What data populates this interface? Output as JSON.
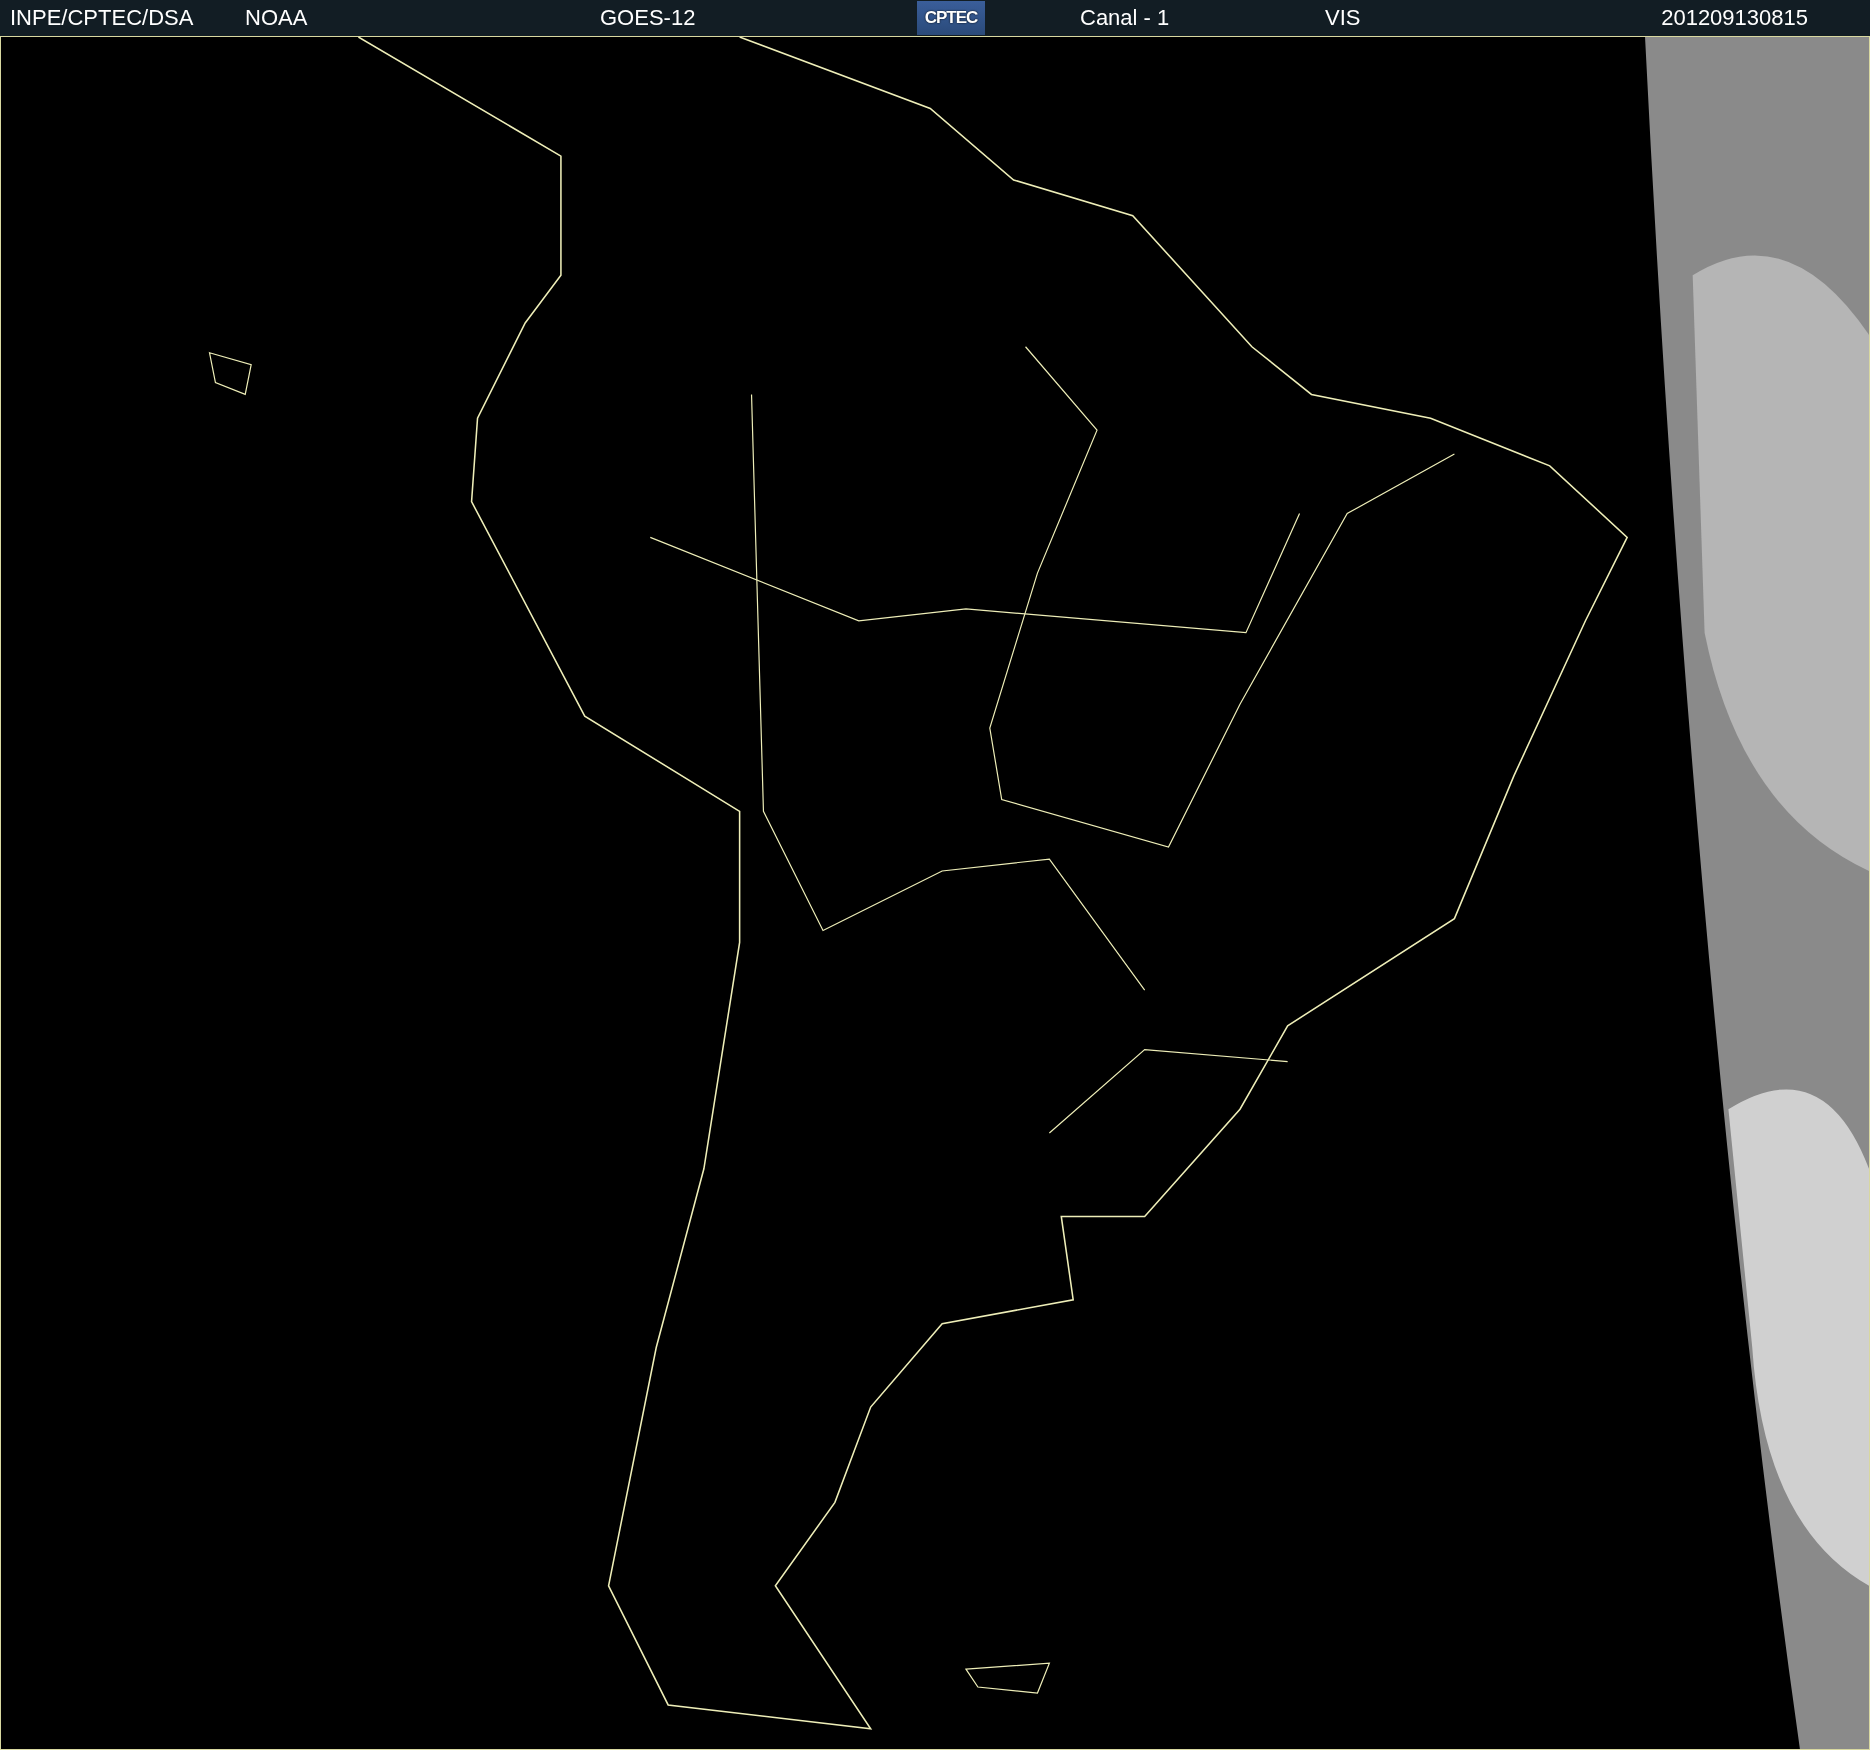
{
  "header": {
    "items": [
      {
        "kind": "text",
        "text": "INPE/CPTEC/DSA"
      },
      {
        "kind": "text",
        "text": "NOAA"
      },
      {
        "kind": "text",
        "text": "GOES-12"
      },
      {
        "kind": "logo",
        "text": "CPTEC"
      },
      {
        "kind": "text",
        "text": "Canal - 1"
      },
      {
        "kind": "text",
        "text": "VIS"
      },
      {
        "kind": "text",
        "text": "201209130815"
      }
    ]
  }
}
